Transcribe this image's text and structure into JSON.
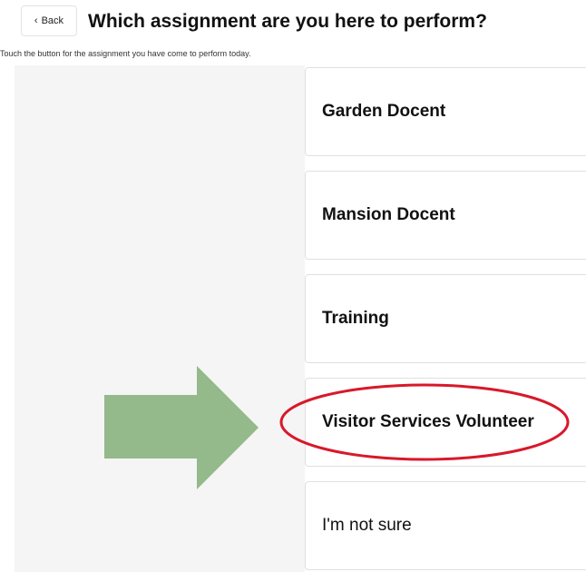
{
  "header": {
    "back_label": "Back",
    "title": "Which assignment are you here to perform?",
    "subtitle": "Touch the button for the assignment you have come to perform today."
  },
  "assignments": [
    {
      "label": "Garden Docent"
    },
    {
      "label": "Mansion Docent"
    },
    {
      "label": "Training"
    },
    {
      "label": "Visitor Services Volunteer"
    },
    {
      "label": "I'm not sure"
    }
  ],
  "annotations": {
    "arrow_color": "#94b98a",
    "highlight_color": "#d9182a",
    "highlighted_item": "Visitor Services Volunteer"
  },
  "icons": {
    "back": "chevron-left-icon"
  }
}
